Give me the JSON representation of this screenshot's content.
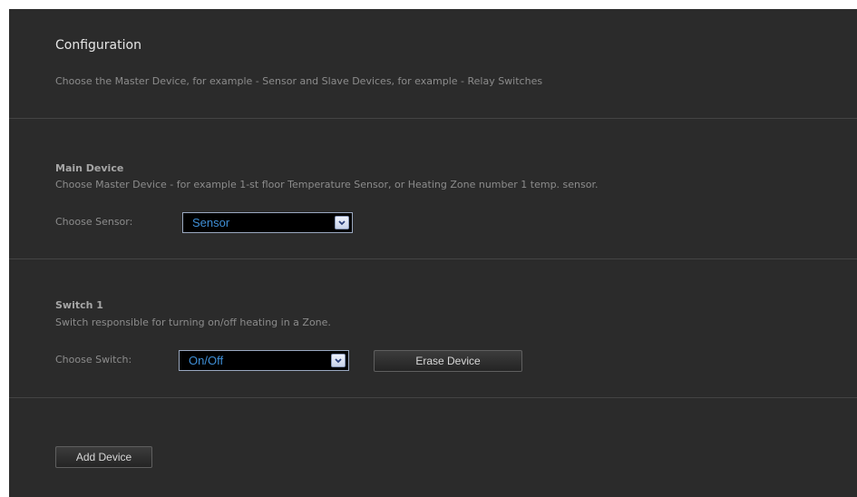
{
  "config": {
    "title": "Configuration",
    "subtitle": "Choose the Master Device, for example - Sensor and Slave Devices, for example - Relay Switches"
  },
  "main_device": {
    "heading": "Main Device",
    "description": "Choose Master Device - for example 1-st floor Temperature Sensor, or Heating Zone number 1 temp. sensor.",
    "sensor_label": "Choose Sensor:",
    "sensor_value": "Sensor"
  },
  "switch1": {
    "heading": "Switch 1",
    "description": "Switch responsible for turning on/off heating in a Zone.",
    "switch_label": "Choose Switch:",
    "switch_value": "On/Off",
    "erase_label": "Erase Device"
  },
  "footer": {
    "add_label": "Add Device"
  },
  "icons": {
    "dropdown": "chevron-down-icon"
  },
  "colors": {
    "panel_bg": "#2b2b2b",
    "select_text": "#3f8fd6"
  }
}
